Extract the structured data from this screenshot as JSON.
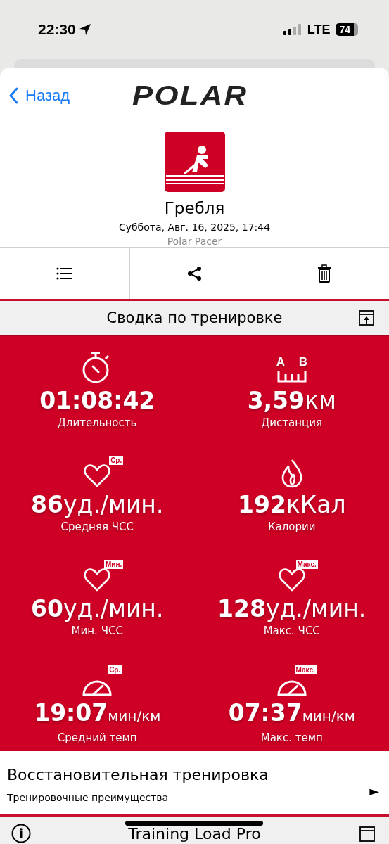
{
  "status_bar": {
    "time": "22:30",
    "network": "LTE",
    "battery": "74"
  },
  "nav": {
    "back": "Назад",
    "logo": "POLAR"
  },
  "session": {
    "sport": "Гребля",
    "datetime": "Суббота, Авг. 16, 2025, 17:44",
    "device": "Polar Pacer"
  },
  "actions": [
    {
      "kind": "list"
    },
    {
      "kind": "share"
    },
    {
      "kind": "delete"
    }
  ],
  "summary": {
    "title": "Сводка по тренировке",
    "distance_icon_marks": [
      "A",
      "B"
    ],
    "stats": [
      {
        "kind": "duration",
        "value": "01:08:42",
        "label": "Длительность"
      },
      {
        "kind": "distance",
        "value": "3,59",
        "unit": "км",
        "label": "Дистанция"
      },
      {
        "kind": "heart_rate",
        "badge": "Ср.",
        "value": "86",
        "unit": "уд./мин.",
        "label": "Средняя ЧСС"
      },
      {
        "kind": "calories",
        "value": "192",
        "unit": "кКал",
        "label": "Калории"
      },
      {
        "kind": "heart_rate",
        "badge": "Мин.",
        "value": "60",
        "unit": "уд./мин.",
        "label": "Мин. ЧСС"
      },
      {
        "kind": "heart_rate",
        "badge": "Макс.",
        "value": "128",
        "unit": "уд./мин.",
        "label": "Макс. ЧСС"
      },
      {
        "kind": "pace",
        "badge": "Ср.",
        "value": "19:07",
        "unit": "мин/км",
        "label": "Средний темп"
      },
      {
        "kind": "pace",
        "badge": "Макс.",
        "value": "07:37",
        "unit": "мин/км",
        "label": "Макс. темп"
      }
    ]
  },
  "benefit": {
    "title": "Восстановительная тренировка",
    "subtitle": "Тренировочные преимущества",
    "arrow": "►"
  },
  "next_section": {
    "title": "Training Load Pro"
  }
}
